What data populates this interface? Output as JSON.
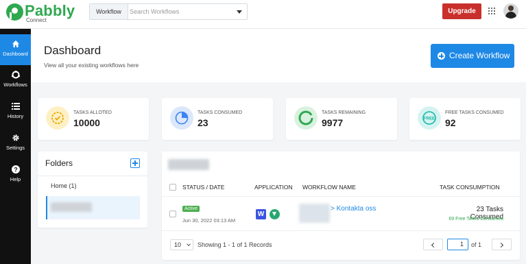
{
  "brand": {
    "name": "Pabbly",
    "sub": "Connect",
    "color": "#2fa84f"
  },
  "search": {
    "category": "Workflow",
    "placeholder": "Search Workflows"
  },
  "header": {
    "upgrade_label": "Upgrade"
  },
  "sidebar": {
    "items": [
      {
        "label": "Dashboard",
        "icon": "home-icon",
        "active": true
      },
      {
        "label": "Workflows",
        "icon": "workflows-icon",
        "active": false
      },
      {
        "label": "History",
        "icon": "history-icon",
        "active": false
      },
      {
        "label": "Settings",
        "icon": "gear-icon",
        "active": false
      },
      {
        "label": "Help",
        "icon": "help-icon",
        "active": false
      }
    ]
  },
  "page": {
    "title": "Dashboard",
    "subtitle": "View all your existing workflows here",
    "create_label": "Create Workflow"
  },
  "stats": [
    {
      "label": "TASKS ALLOTED",
      "value": "10000",
      "icon": "badge-check-icon",
      "color": "#f4b400"
    },
    {
      "label": "TASKS CONSUMED",
      "value": "23",
      "icon": "pie-chart-icon",
      "color": "#3b82f6"
    },
    {
      "label": "TASKS REMAINING",
      "value": "9977",
      "icon": "progress-ring-icon",
      "color": "#2fa84f"
    },
    {
      "label": "FREE TASKS CONSUMED",
      "value": "92",
      "icon": "free-badge-icon",
      "color": "#14b8a6"
    }
  ],
  "folders": {
    "title": "Folders",
    "items": [
      {
        "label": "Home (1)"
      }
    ]
  },
  "table": {
    "columns": [
      "STATUS / DATE",
      "APPLICATION",
      "WORKFLOW NAME",
      "TASK CONSUMPTION"
    ],
    "rows": [
      {
        "status": "Active",
        "date": "Jun 30, 2022 03:13 AM",
        "apps": [
          "webflow-icon",
          "filter-icon"
        ],
        "name": "> Kontakta oss",
        "consumed": "23 Tasks Consumed",
        "free_consumed": "69 Free Tasks Consumed"
      }
    ],
    "per_page": "10",
    "records_text": "Showing 1 - 1 of 1 Records",
    "page_current": "1",
    "page_total_text": "of 1"
  },
  "colors": {
    "accent": "#1e88e5",
    "upgrade": "#c9302c",
    "sidebar_bg": "#111111",
    "active_badge": "#4caf50"
  }
}
